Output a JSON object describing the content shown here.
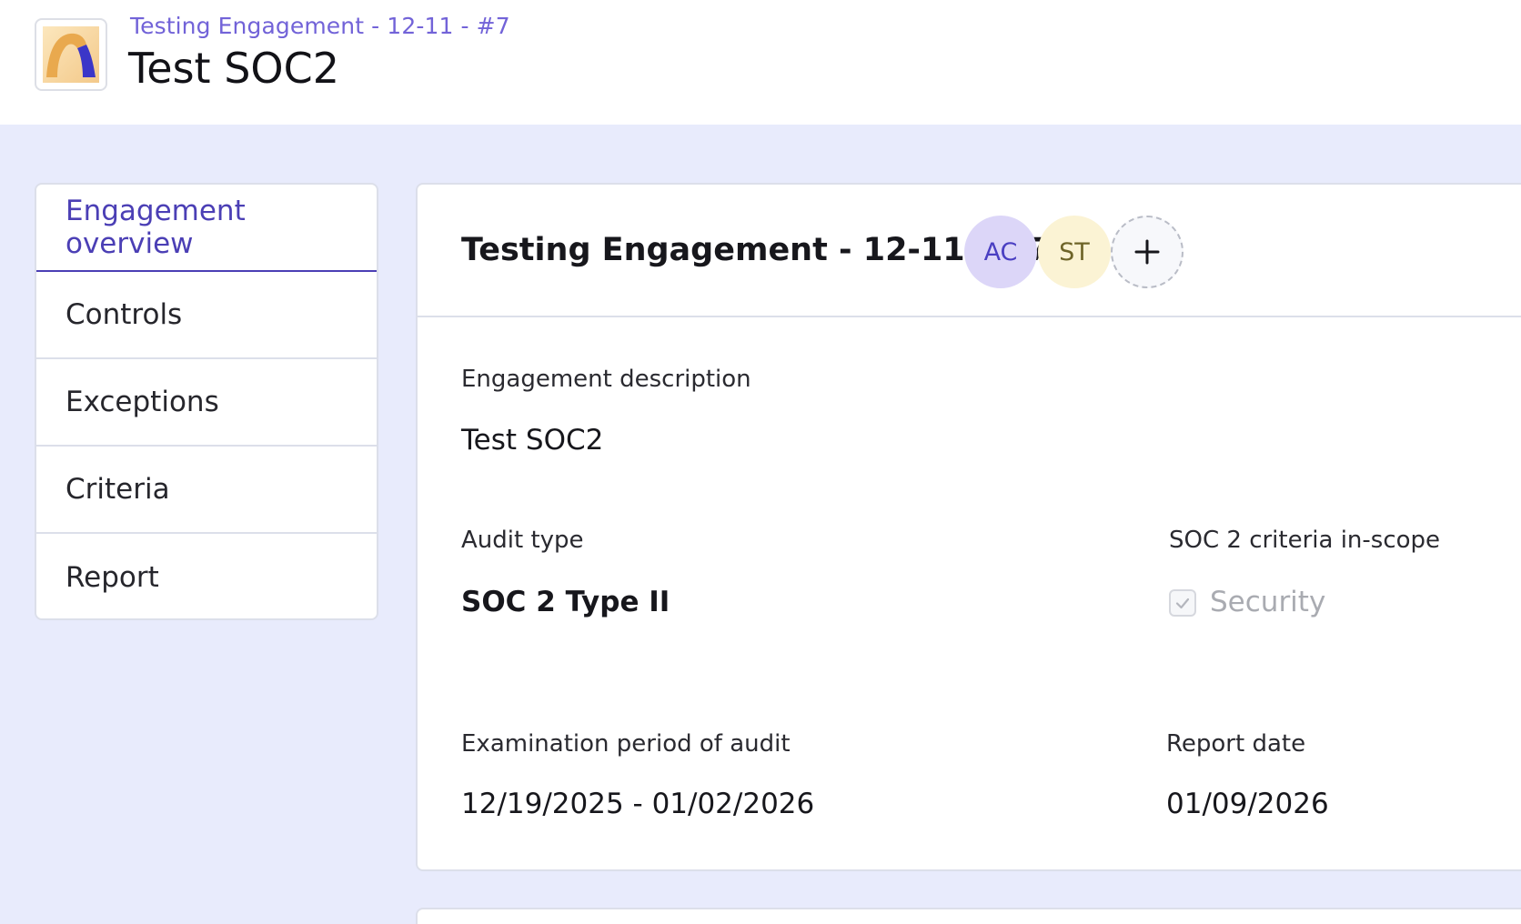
{
  "header": {
    "breadcrumb": "Testing Engagement - 12-11 - #7",
    "title": "Test SOC2",
    "logo_icon": "arch-logo-icon"
  },
  "nav": {
    "items": [
      {
        "label": "Engagement overview",
        "active": true
      },
      {
        "label": "Controls"
      },
      {
        "label": "Exceptions"
      },
      {
        "label": "Criteria"
      },
      {
        "label": "Report"
      }
    ]
  },
  "engagement": {
    "title": "Testing Engagement - 12-11 - #7",
    "avatars": [
      {
        "initials": "AC"
      },
      {
        "initials": "ST"
      }
    ],
    "add_member_icon": "plus-icon",
    "description_label": "Engagement description",
    "description_value": "Test SOC2",
    "audit_type_label": "Audit type",
    "audit_type_value": "SOC 2 Type II",
    "criteria_label": "SOC 2 criteria in-scope",
    "criteria_items": [
      {
        "label": "Security",
        "checked": true,
        "disabled": true
      }
    ],
    "period_label": "Examination period of audit",
    "period_value": "12/19/2025 - 01/02/2026",
    "report_date_label": "Report date",
    "report_date_value": "01/09/2026"
  },
  "colors": {
    "accent": "#4b3fb5",
    "breadcrumb": "#7263d8",
    "page_background": "#e8ebfc"
  }
}
